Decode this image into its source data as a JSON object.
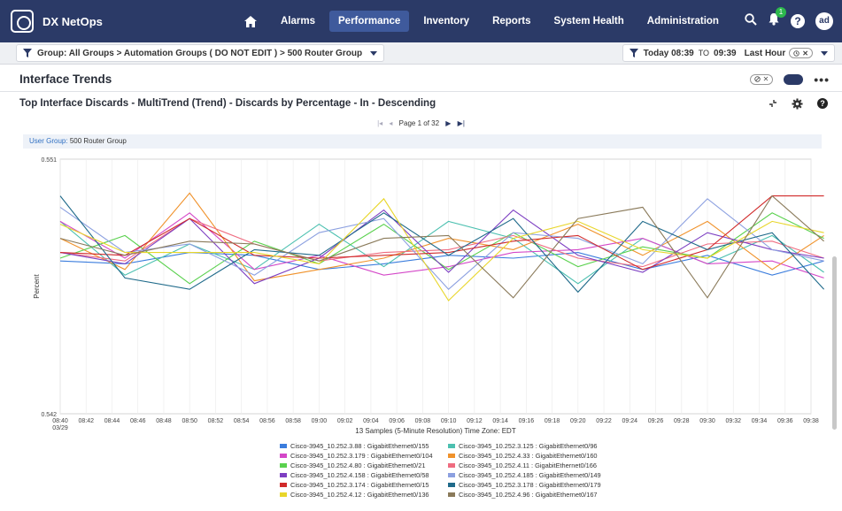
{
  "app": {
    "name": "DX NetOps"
  },
  "nav": {
    "items": [
      "Alarms",
      "Performance",
      "Inventory",
      "Reports",
      "System Health",
      "Administration"
    ],
    "active": "Performance"
  },
  "header": {
    "notification_count": "1",
    "help_icon": "?",
    "avatar_initials": "ad"
  },
  "filter": {
    "group_label": "Group: All Groups > Automation Groups ( DO NOT EDIT ) > 500 Router Group",
    "time_start": "Today 08:39",
    "time_to": "TO",
    "time_end": "09:39",
    "time_range": "Last Hour"
  },
  "section": {
    "title": "Interface Trends"
  },
  "panel": {
    "title": "Top Interface Discards - MultiTrend (Trend) - Discards by Percentage - In - Descending"
  },
  "pager": {
    "text": "Page 1 of 32"
  },
  "user_group": {
    "label": "User Group:",
    "value": "500 Router Group"
  },
  "chart_data": {
    "type": "line",
    "ylabel": "Percent",
    "ylim": [
      0.542,
      0.551
    ],
    "ytick_labels": [
      "0.551",
      "0.542"
    ],
    "x": [
      "08:40",
      "08:42",
      "08:44",
      "08:46",
      "08:48",
      "08:50",
      "08:52",
      "08:54",
      "08:56",
      "08:58",
      "09:00",
      "09:02",
      "09:04",
      "09:06",
      "09:08",
      "09:10",
      "09:12",
      "09:14",
      "09:16",
      "09:18",
      "09:20",
      "09:22",
      "09:24",
      "09:26",
      "09:28",
      "09:30",
      "09:32",
      "09:34",
      "09:36",
      "09:38"
    ],
    "x_sublabel": "03/29",
    "xlabel": "13 Samples (5-Minute Resolution) Time Zone: EDT",
    "grid": true,
    "sample_times": [
      "08:40",
      "08:45",
      "08:50",
      "08:55",
      "09:00",
      "09:05",
      "09:10",
      "09:15",
      "09:20",
      "09:25",
      "09:30",
      "09:35",
      "09:39"
    ],
    "series": [
      {
        "name": "Cisco-3945_10.252.3.88 : GigabitEthernet0/155",
        "color": "#3b7ddd",
        "values": [
          0.5474,
          0.5473,
          0.5477,
          0.5476,
          0.5471,
          0.5473,
          0.5476,
          0.5475,
          0.5477,
          0.5471,
          0.5476,
          0.5469,
          0.5474
        ]
      },
      {
        "name": "Cisco-3945_10.252.3.125 : GigabitEthernet0/96",
        "color": "#4cc0b0",
        "values": [
          0.5488,
          0.5469,
          0.548,
          0.5471,
          0.5487,
          0.5472,
          0.5488,
          0.5482,
          0.5466,
          0.5482,
          0.5473,
          0.5483,
          0.547
        ]
      },
      {
        "name": "Cisco-3945_10.252.3.179 : GigabitEthernet0/104",
        "color": "#d447c8",
        "values": [
          0.5488,
          0.5475,
          0.5491,
          0.5471,
          0.5476,
          0.5469,
          0.5472,
          0.5477,
          0.5478,
          0.5482,
          0.5473,
          0.5474,
          0.5468
        ]
      },
      {
        "name": "Cisco-3945_10.252.4.33 : GigabitEthernet0/160",
        "color": "#f0922b",
        "values": [
          0.5482,
          0.5471,
          0.5498,
          0.5467,
          0.5471,
          0.5475,
          0.5482,
          0.5478,
          0.5487,
          0.5476,
          0.5488,
          0.5471,
          0.5483
        ]
      },
      {
        "name": "Cisco-3945_10.252.4.80 : GigabitEthernet0/21",
        "color": "#5ad14e",
        "values": [
          0.5475,
          0.5483,
          0.5466,
          0.5481,
          0.5473,
          0.5487,
          0.5471,
          0.5484,
          0.5472,
          0.5479,
          0.5475,
          0.5491,
          0.5482
        ]
      },
      {
        "name": "Cisco-3945_10.252.4.11 : GigabitEthernet0/166",
        "color": "#ef6c80",
        "values": [
          0.5477,
          0.5474,
          0.5489,
          0.548,
          0.5474,
          0.5477,
          0.5478,
          0.5483,
          0.5475,
          0.5472,
          0.548,
          0.5481,
          0.5475
        ]
      },
      {
        "name": "Cisco-3945_10.252.4.158 : GigabitEthernet0/58",
        "color": "#7d3fc2",
        "values": [
          0.5477,
          0.5473,
          0.5489,
          0.5466,
          0.5475,
          0.5492,
          0.547,
          0.5492,
          0.5476,
          0.547,
          0.5484,
          0.5478,
          0.5475
        ]
      },
      {
        "name": "Cisco-3945_10.252.4.185 : GigabitEthernet0/149",
        "color": "#8ca0e0",
        "values": [
          0.5493,
          0.5477,
          0.548,
          0.5469,
          0.5484,
          0.5489,
          0.5464,
          0.5484,
          0.5482,
          0.5473,
          0.5496,
          0.5478,
          0.5474
        ]
      },
      {
        "name": "Cisco-3945_10.252.3.174 : GigabitEthernet0/15",
        "color": "#d12a2a",
        "values": [
          0.5477,
          0.5476,
          0.5489,
          0.5476,
          0.5475,
          0.5476,
          0.5477,
          0.5481,
          0.5483,
          0.5471,
          0.5478,
          0.5497,
          0.5497
        ]
      },
      {
        "name": "Cisco-3945_10.252.3.178 : GigabitEthernet0/179",
        "color": "#1f6a8a",
        "values": [
          0.5497,
          0.5468,
          0.5464,
          0.5478,
          0.5476,
          0.5491,
          0.5476,
          0.5489,
          0.5463,
          0.5488,
          0.5478,
          0.5484,
          0.5464
        ]
      },
      {
        "name": "Cisco-3945_10.252.4.12 : GigabitEthernet0/136",
        "color": "#e8d62a",
        "values": [
          0.5487,
          0.5477,
          0.5477,
          0.5477,
          0.5473,
          0.5496,
          0.546,
          0.5482,
          0.5488,
          0.5478,
          0.5475,
          0.5488,
          0.5484
        ]
      },
      {
        "name": "Cisco-3945_10.252.4.96 : GigabitEthernet0/167",
        "color": "#8a7a5a",
        "values": [
          0.5482,
          0.5476,
          0.5481,
          0.548,
          0.5474,
          0.5482,
          0.5483,
          0.5461,
          0.5489,
          0.5493,
          0.5461,
          0.5497,
          0.5481
        ]
      }
    ],
    "legend": [
      {
        "name": "Cisco-3945_10.252.3.88 : GigabitEthernet0/155",
        "color": "#3b7ddd"
      },
      {
        "name": "Cisco-3945_10.252.3.125 : GigabitEthernet0/96",
        "color": "#4cc0b0"
      },
      {
        "name": "Cisco-3945_10.252.3.179 : GigabitEthernet0/104",
        "color": "#d447c8"
      },
      {
        "name": "Cisco-3945_10.252.4.33 : GigabitEthernet0/160",
        "color": "#f0922b"
      },
      {
        "name": "Cisco-3945_10.252.4.80 : GigabitEthernet0/21",
        "color": "#5ad14e"
      },
      {
        "name": "Cisco-3945_10.252.4.11 : GigabitEthernet0/166",
        "color": "#ef6c80"
      },
      {
        "name": "Cisco-3945_10.252.4.158 : GigabitEthernet0/58",
        "color": "#7d3fc2"
      },
      {
        "name": "Cisco-3945_10.252.4.185 : GigabitEthernet0/149",
        "color": "#8ca0e0"
      },
      {
        "name": "Cisco-3945_10.252.3.174 : GigabitEthernet0/15",
        "color": "#d12a2a"
      },
      {
        "name": "Cisco-3945_10.252.3.178 : GigabitEthernet0/179",
        "color": "#1f6a8a"
      },
      {
        "name": "Cisco-3945_10.252.4.12 : GigabitEthernet0/136",
        "color": "#e8d62a"
      },
      {
        "name": "Cisco-3945_10.252.4.96 : GigabitEthernet0/167",
        "color": "#8a7a5a"
      }
    ]
  }
}
